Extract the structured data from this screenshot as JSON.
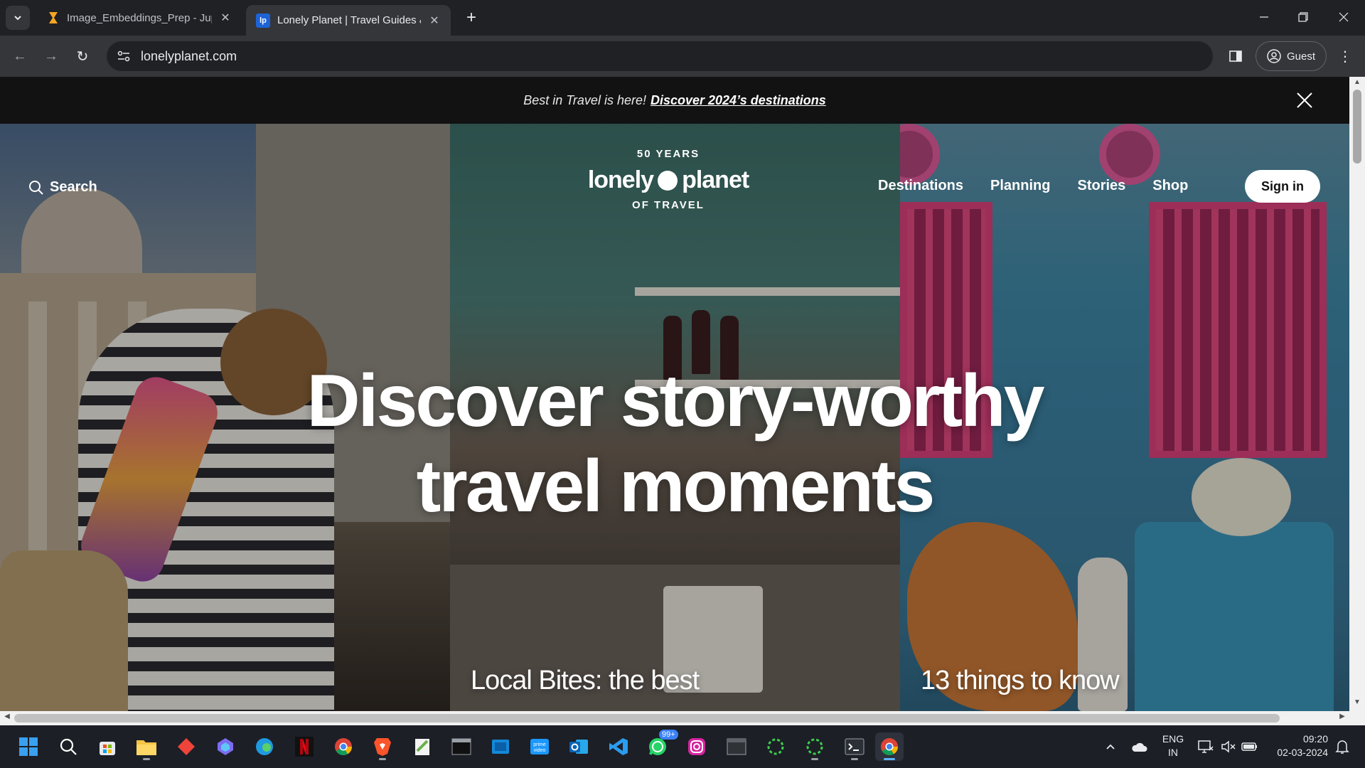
{
  "browser": {
    "tabs": [
      {
        "title": "Image_Embeddings_Prep - Jupyter",
        "active": false
      },
      {
        "title": "Lonely Planet | Travel Guides & Travel Information",
        "active": true
      }
    ],
    "url": "lonelyplanet.com",
    "profile_label": "Guest"
  },
  "promo": {
    "text": "Best in Travel is here!",
    "link": "Discover 2024’s destinations"
  },
  "header": {
    "search_label": "Search",
    "logo": {
      "top": "50 YEARS",
      "main_left": "lonely",
      "main_right": "planet",
      "bottom": "OF TRAVEL"
    },
    "nav": [
      "Destinations",
      "Planning",
      "Stories",
      "Shop"
    ],
    "signin_label": "Sign in"
  },
  "hero": {
    "headline_line1": "Discover story-worthy",
    "headline_line2": "travel moments",
    "captions": [
      "Local Bites: the best",
      "13 things to know"
    ]
  },
  "taskbar": {
    "apps": [
      "windows-start",
      "search",
      "microsoft-store",
      "file-explorer",
      "anydesk",
      "copilot",
      "edge",
      "netflix",
      "chrome",
      "brave",
      "notepad-plus",
      "terminal-window",
      "microsoft-store-app",
      "prime-video",
      "outlook",
      "vscode",
      "whatsapp",
      "instagram",
      "window-app",
      "spinner-app-1",
      "spinner-app-2",
      "terminal",
      "chrome-active"
    ],
    "whatsapp_badge": "99+",
    "lang_line1": "ENG",
    "lang_line2": "IN",
    "time": "09:20",
    "date": "02-03-2024"
  },
  "colors": {
    "browser_dark": "#202124",
    "toolbar": "#35363a",
    "promo_bg": "#121212",
    "window_pink": "#e0487e",
    "wall_blue": "#3d87a6",
    "taskbar": "#1c1f26"
  }
}
